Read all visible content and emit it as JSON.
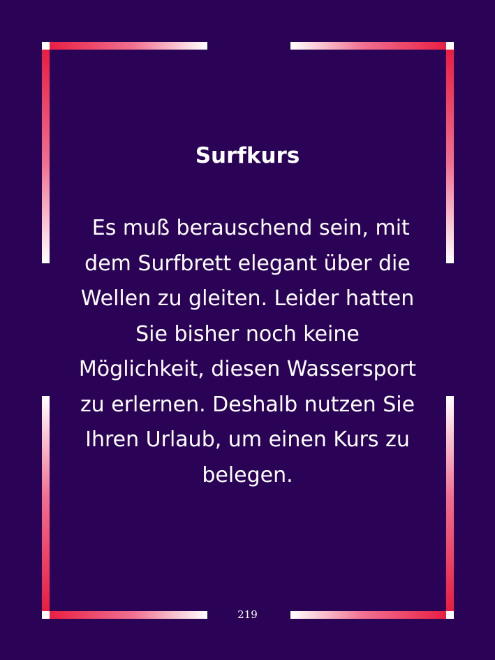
{
  "card": {
    "title": "Surfkurs",
    "text": " Es muß berauschend sein, mit\ndem Surfbrett elegant über die\nWellen zu gleiten. Leider hatten\nSie bisher noch keine\nMöglichkeit, diesen Wassersport\nzu erlernen. Deshalb nutzen Sie\nIhren Urlaub, um einen Kurs zu\nbelegen.",
    "page_number": "219"
  },
  "colors": {
    "background": "#2b0356",
    "frame_accent": "#e8183c",
    "frame_light": "#ffffff",
    "text": "#ffffff"
  }
}
